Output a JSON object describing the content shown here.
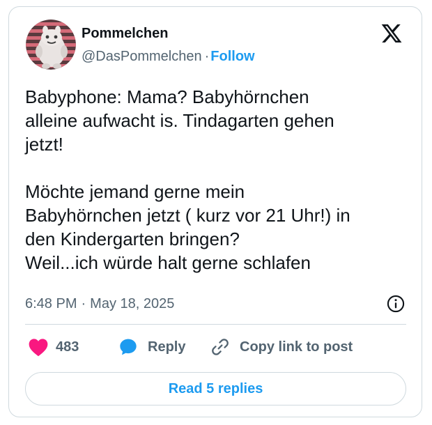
{
  "author": {
    "display_name": "Pommelchen",
    "handle": "@DasPommelchen",
    "separator": "·",
    "follow_label": "Follow",
    "avatar_icon": "pink-monster-avatar"
  },
  "platform_icon": "x-logo-icon",
  "tweet": {
    "lines": [
      "Babyphone: Mama? Babyhörnchen",
      "alleine aufwacht is. Tindagarten gehen",
      "jetzt!",
      "",
      "Möchte jemand gerne mein",
      "Babyhörnchen jetzt ( kurz vor 21 Uhr!) in",
      "den Kindergarten bringen?",
      "Weil...ich würde halt gerne schlafen"
    ]
  },
  "meta": {
    "time": "6:48 PM",
    "separator": "·",
    "date": "May 18, 2025",
    "info_icon": "info-icon"
  },
  "actions": {
    "like_count": "483",
    "reply_label": "Reply",
    "copy_label": "Copy link to post"
  },
  "read_replies_label": "Read 5 replies",
  "colors": {
    "accent": "#1d9bf0",
    "like": "#f91880",
    "text": "#0f1419",
    "secondary": "#536471",
    "border": "#cfd9de"
  }
}
